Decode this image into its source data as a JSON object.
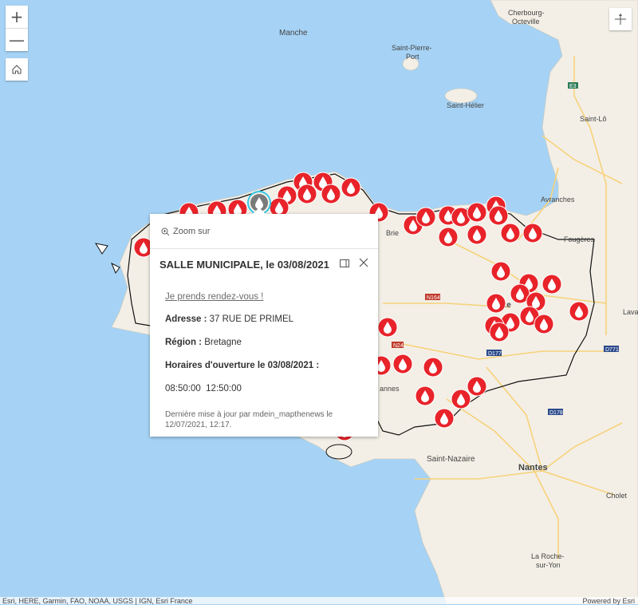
{
  "map": {
    "place_labels": [
      {
        "text": "Manche",
        "kind": "sea"
      },
      {
        "text": "Cherbourg-",
        "kind": "city"
      },
      {
        "text": "Octeville",
        "kind": "city"
      },
      {
        "text": "Saint-Pierre-",
        "kind": "city"
      },
      {
        "text": "Port",
        "kind": "city"
      },
      {
        "text": "Saint-Hélier",
        "kind": "city"
      },
      {
        "text": "Saint-Lô",
        "kind": "city"
      },
      {
        "text": "Avranches",
        "kind": "city"
      },
      {
        "text": "Fougères",
        "kind": "city"
      },
      {
        "text": "Lava",
        "kind": "city"
      },
      {
        "text": "Saint-Nazaire",
        "kind": "city"
      },
      {
        "text": "Nantes",
        "kind": "city"
      },
      {
        "text": "Cholet",
        "kind": "city"
      },
      {
        "text": "La Roche-",
        "kind": "city"
      },
      {
        "text": "sur-Yon",
        "kind": "city"
      },
      {
        "text": "Re",
        "kind": "city"
      },
      {
        "text": "Brie",
        "kind": "city"
      },
      {
        "text": "annes",
        "kind": "city"
      }
    ],
    "road_shields": [
      "E3",
      "N164",
      "N24",
      "D177",
      "D771",
      "D178"
    ],
    "marker_icon": "blood-drop-icon",
    "marker_color": "#e8232a",
    "selected_marker_color": "#7a7a7a",
    "land_color": "#f3efe6",
    "water_color": "#a6d3f5"
  },
  "controls": {
    "zoom_in": "+",
    "zoom_out": "—",
    "home_icon": "home-icon",
    "compass_icon": "compass-icon"
  },
  "popup": {
    "zoom_action": "Zoom sur",
    "title": "SALLE MUNICIPALE, le 03/08/2021",
    "link": "Je prends rendez-vous !",
    "address_label": "Adresse :",
    "address_value": "37 RUE DE PRIMEL",
    "region_label": "Région :",
    "region_value": "Bretagne",
    "hours_label": "Horaires d'ouverture le 03/08/2021 :",
    "hours_value": "08:50:00  12:50:00",
    "last_update": "Dernière mise à jour par mdein_mapthenews le 12/07/2021, 12:17."
  },
  "attribution": {
    "left": "Esri, HERE, Garmin, FAO, NOAA, USGS | IGN, Esri France",
    "right": "Powered by Esri"
  }
}
